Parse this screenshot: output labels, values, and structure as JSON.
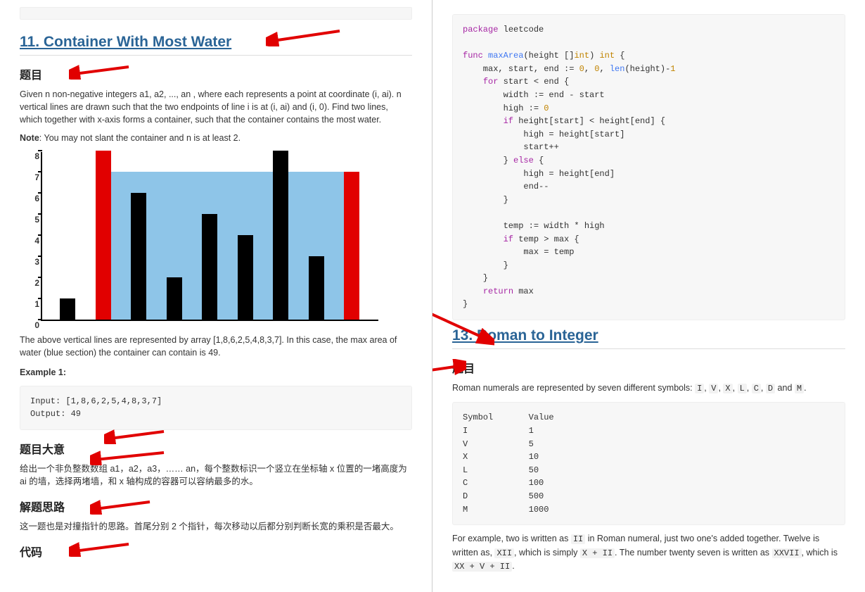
{
  "left": {
    "title": "11. Container With Most Water",
    "section_problem": "题目",
    "desc1": "Given n non-negative integers a1, a2, ..., an , where each represents a point at coordinate (i, ai). n vertical lines are drawn such that the two endpoints of line i is at (i, ai) and (i, 0). Find two lines, which together with x-axis forms a container, such that the container contains the most water.",
    "note_label": "Note",
    "note_text": ": You may not slant the container and n is at least 2.",
    "caption": "The above vertical lines are represented by array [1,8,6,2,5,4,8,3,7]. In this case, the max area of water (blue section) the container can contain is 49.",
    "example_label": "Example 1:",
    "example_code": "Input: [1,8,6,2,5,4,8,3,7]\nOutput: 49",
    "section_meaning": "题目大意",
    "meaning_text": "给出一个非负整数数组 a1，a2，a3，…… an，每个整数标识一个竖立在坐标轴 x 位置的一堵高度为 ai 的墙，选择两堵墙，和 x 轴构成的容器可以容纳最多的水。",
    "section_solution": "解题思路",
    "solution_text": "这一题也是对撞指针的思路。首尾分别 2 个指针，每次移动以后都分别判断长宽的乘积是否最大。",
    "section_code": "代码"
  },
  "chart_data": {
    "type": "bar",
    "x": [
      1,
      2,
      3,
      4,
      5,
      6,
      7,
      8,
      9
    ],
    "values": [
      1,
      8,
      6,
      2,
      5,
      4,
      8,
      3,
      7
    ],
    "highlight_indices": [
      1,
      8
    ],
    "water_level": 7,
    "water_from_index": 1,
    "water_to_index": 8,
    "ylim": [
      0,
      8
    ],
    "yticks": [
      0,
      1,
      2,
      3,
      4,
      5,
      6,
      7,
      8
    ],
    "title": "",
    "xlabel": "",
    "ylabel": ""
  },
  "right": {
    "title2": "13. Roman to Integer",
    "section_problem": "题目",
    "desc": "Roman numerals are represented by seven different symbols: ",
    "symbols_inline": [
      "I",
      "V",
      "X",
      "L",
      "C",
      "D",
      "M"
    ],
    "and_text": " and ",
    "period": ".",
    "table_header": "Symbol       Value",
    "table_rows": [
      "I            1",
      "V            5",
      "X            10",
      "L            50",
      "C            100",
      "D            500",
      "M            1000"
    ],
    "para2_a": "For example, two is written as ",
    "para2_b": " in Roman numeral, just two one's added together. Twelve is written as, ",
    "para2_c": ", which is simply ",
    "para2_d": ". The number twenty seven is written as ",
    "para2_e": ", which is ",
    "codes": {
      "II": "II",
      "XII": "XII",
      "XplusII": "X + II",
      "XXVII": "XXVII",
      "XXplusVplusII": "XX + V + II"
    }
  },
  "code": {
    "go": "package leetcode\n\nfunc maxArea(height []int) int {\n    max, start, end := 0, 0, len(height)-1\n    for start < end {\n        width := end - start\n        high := 0\n        if height[start] < height[end] {\n            high = height[start]\n            start++\n        } else {\n            high = height[end]\n            end--\n        }\n\n        temp := width * high\n        if temp > max {\n            max = temp\n        }\n    }\n    return max\n}"
  }
}
